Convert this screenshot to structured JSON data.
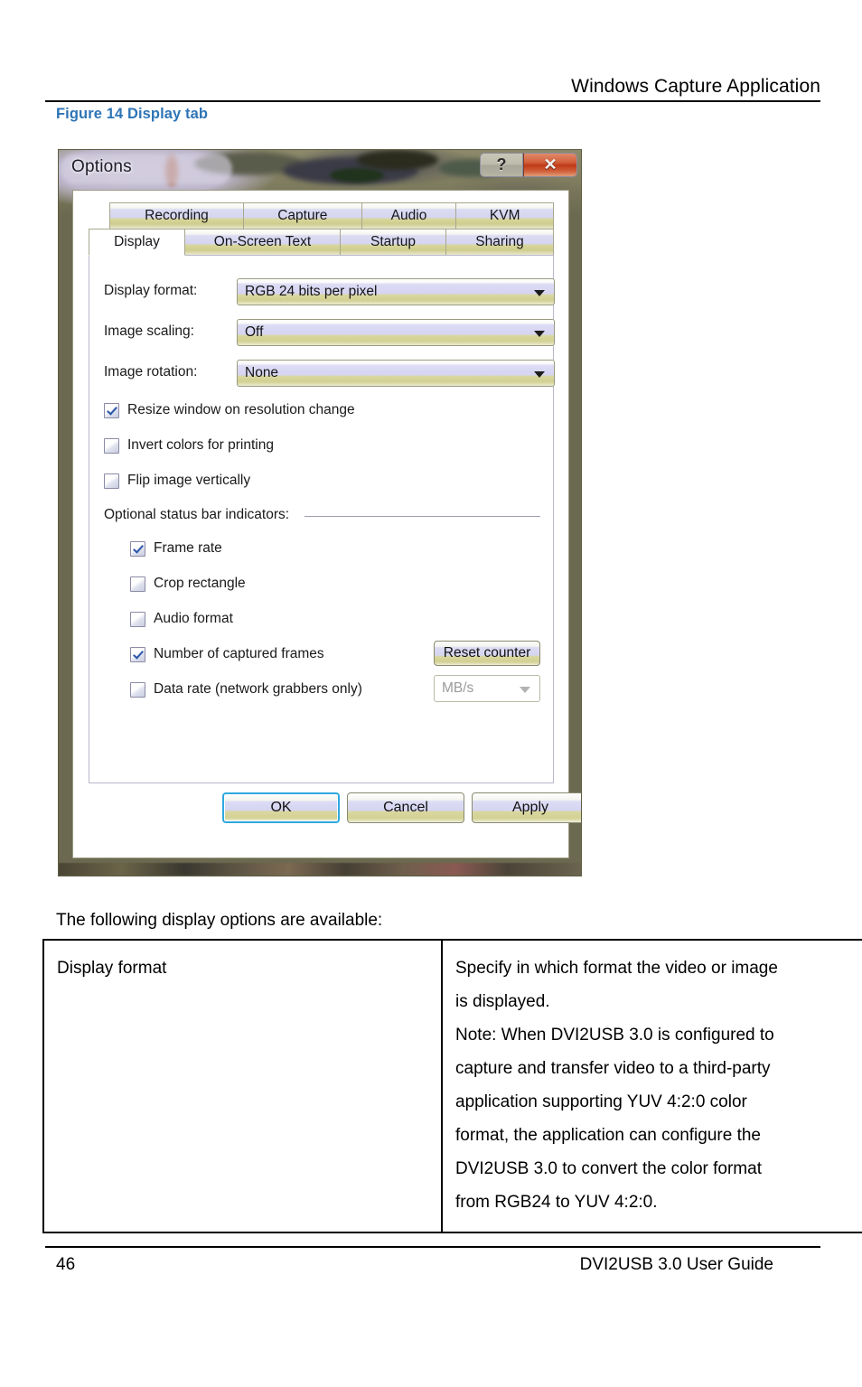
{
  "page": {
    "header_title": "Windows Capture Application",
    "figure_caption": "Figure 14 Display tab",
    "intro_line": "The following display options are available:",
    "footer_page_number": "46",
    "footer_document": "DVI2USB 3.0  User Guide",
    "caption_color": "#2E74B5"
  },
  "dialog": {
    "title": "Options",
    "window_buttons": {
      "help_label": "?",
      "close_label": "✕"
    },
    "tabs_row1": [
      {
        "label": "Recording",
        "selected": false
      },
      {
        "label": "Capture",
        "selected": false
      },
      {
        "label": "Audio",
        "selected": false
      },
      {
        "label": "KVM",
        "selected": false
      }
    ],
    "tabs_row2": [
      {
        "label": "Display",
        "selected": true
      },
      {
        "label": "On-Screen Text",
        "selected": false
      },
      {
        "label": "Startup",
        "selected": false
      },
      {
        "label": "Sharing",
        "selected": false
      }
    ],
    "fields": [
      {
        "label": "Display format:",
        "value": "RGB 24 bits per pixel"
      },
      {
        "label": "Image scaling:",
        "value": "Off"
      },
      {
        "label": "Image rotation:",
        "value": "None"
      }
    ],
    "checkboxes": [
      {
        "label": "Resize window on resolution change",
        "checked": true
      },
      {
        "label": "Invert colors for printing",
        "checked": false
      },
      {
        "label": "Flip image vertically",
        "checked": false
      }
    ],
    "status_group": {
      "title": "Optional status bar indicators:",
      "items": [
        {
          "label": "Frame rate",
          "checked": true
        },
        {
          "label": "Crop rectangle",
          "checked": false
        },
        {
          "label": "Audio format",
          "checked": false
        },
        {
          "label": "Number of captured frames",
          "checked": true
        },
        {
          "label": "Data rate (network grabbers only)",
          "checked": false
        }
      ],
      "reset_button_label": "Reset counter",
      "unit_select_value": "MB/s"
    },
    "actions": {
      "ok_label": "OK",
      "cancel_label": "Cancel",
      "apply_label": "Apply"
    }
  },
  "table": {
    "rows": [
      {
        "option": "Display format",
        "description_lines": [
          "Specify in which format the video or image",
          "is displayed.",
          "Note: When DVI2USB 3.0 is configured to",
          "capture and transfer video to a third-party",
          "application supporting YUV 4:2:0 color",
          "format, the application can configure the",
          "DVI2USB 3.0 to convert the color format",
          "from RGB24 to YUV 4:2:0."
        ]
      }
    ]
  }
}
